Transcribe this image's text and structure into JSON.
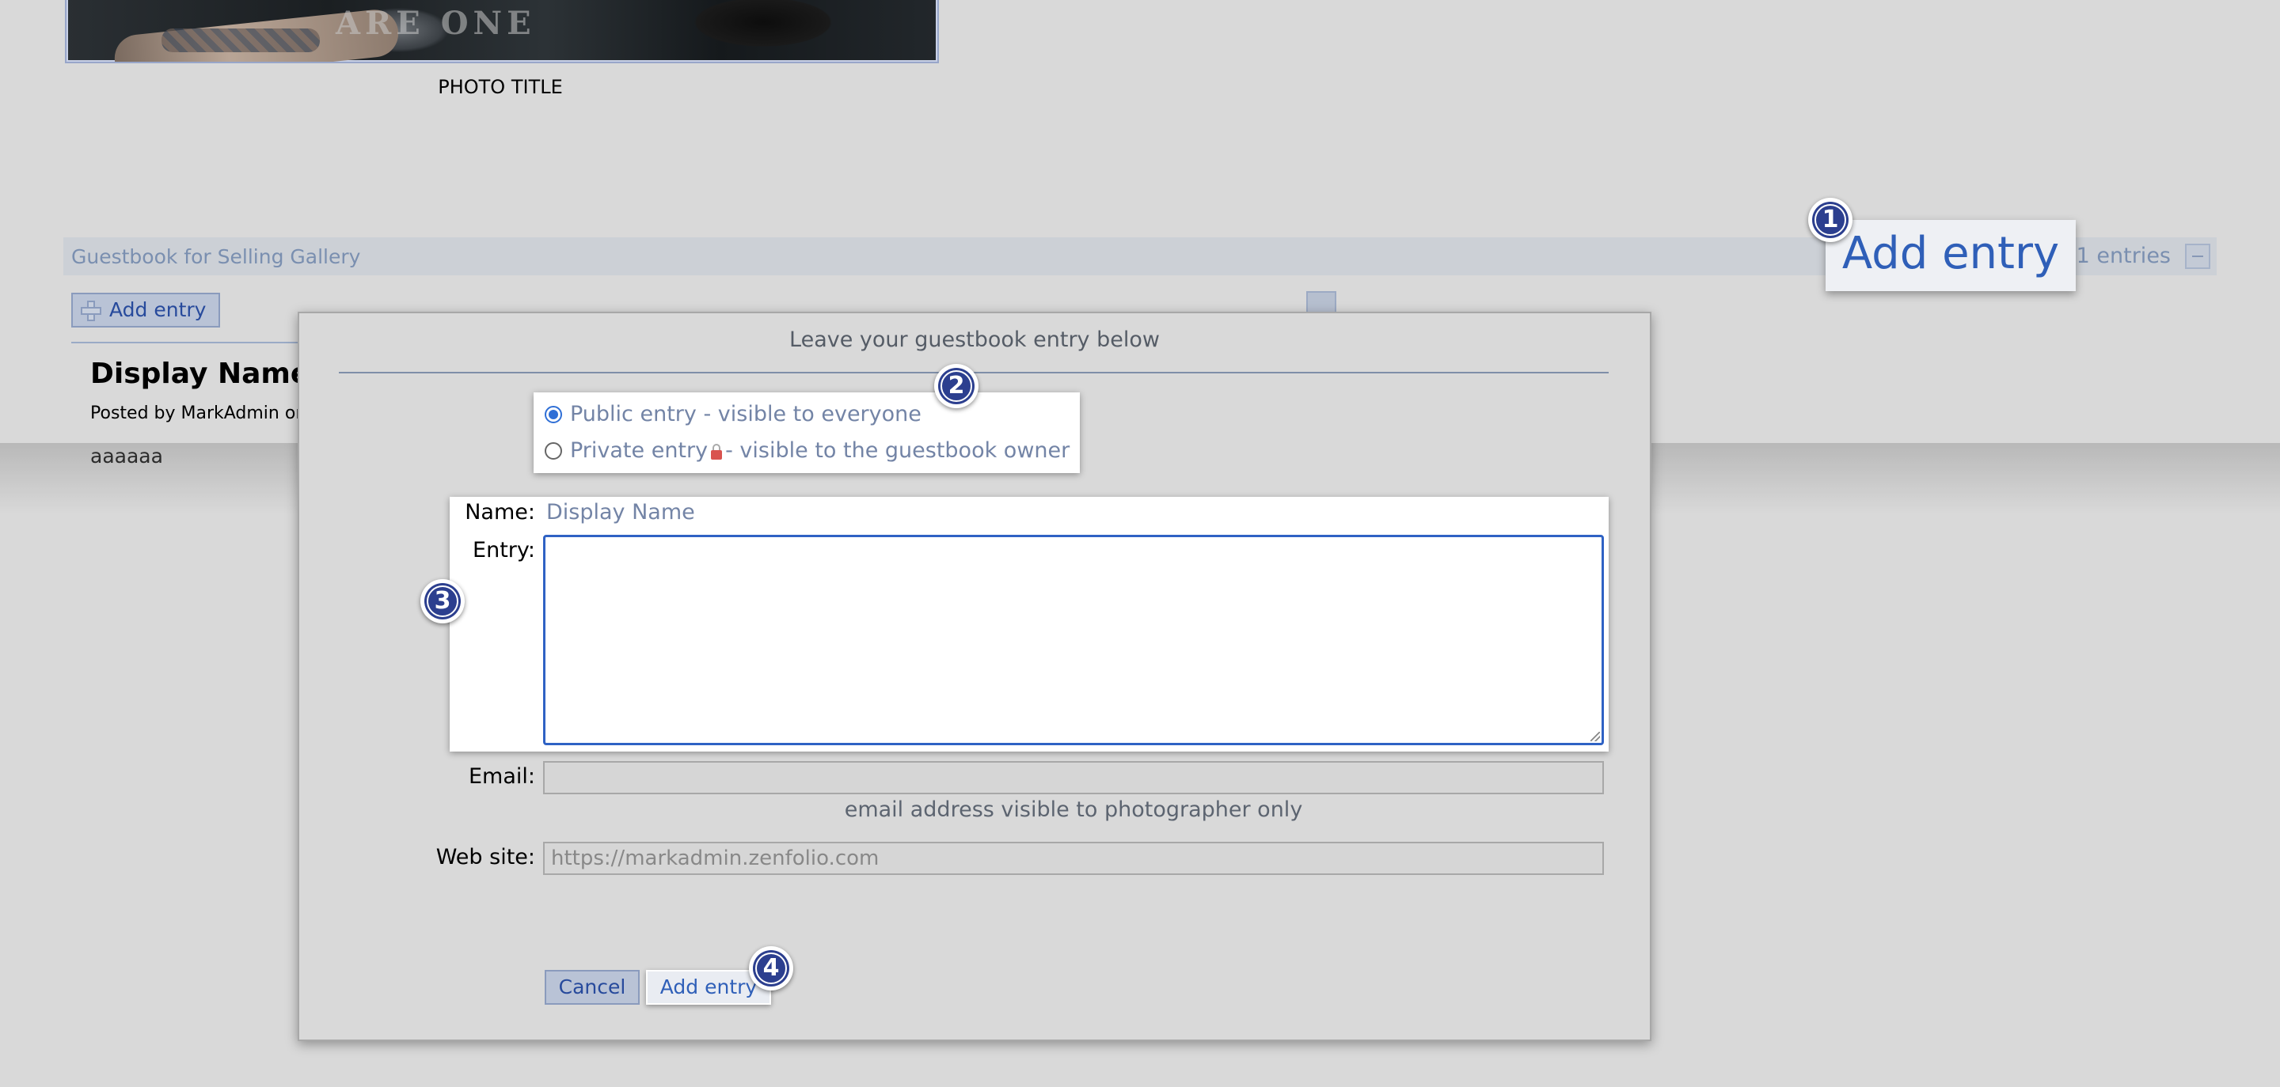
{
  "photo": {
    "title": "PHOTO TITLE",
    "shirt_text": "ARE ONE"
  },
  "guestbook": {
    "title": "Guestbook for Selling Gallery",
    "count": "1 entries",
    "add_entry_label": "Add entry",
    "entries": [
      {
        "name": "Display Name",
        "posted_by": "Posted by MarkAdmin on",
        "text": "aaaaaa"
      }
    ]
  },
  "callouts": {
    "add_entry": "Add entry",
    "steps": [
      "1",
      "2",
      "3",
      "4"
    ]
  },
  "dialog": {
    "title": "Leave your guestbook entry below",
    "privacy": {
      "public_label": "Public entry - visible to everyone",
      "private_label_before": "Private entry",
      "private_label_after": "- visible to the guestbook owner",
      "selected": "public"
    },
    "name_label": "Name:",
    "name_value": "Display Name",
    "entry_label": "Entry:",
    "entry_value": "",
    "email_label": "Email:",
    "email_value": "",
    "email_note": "email address visible to photographer only",
    "website_label": "Web site:",
    "website_placeholder": "https://markadmin.zenfolio.com",
    "cancel_label": "Cancel",
    "submit_label": "Add entry"
  },
  "colors": {
    "accent": "#2f5fb8",
    "badge": "#2c3f8f",
    "muted_text": "#7384a6"
  }
}
